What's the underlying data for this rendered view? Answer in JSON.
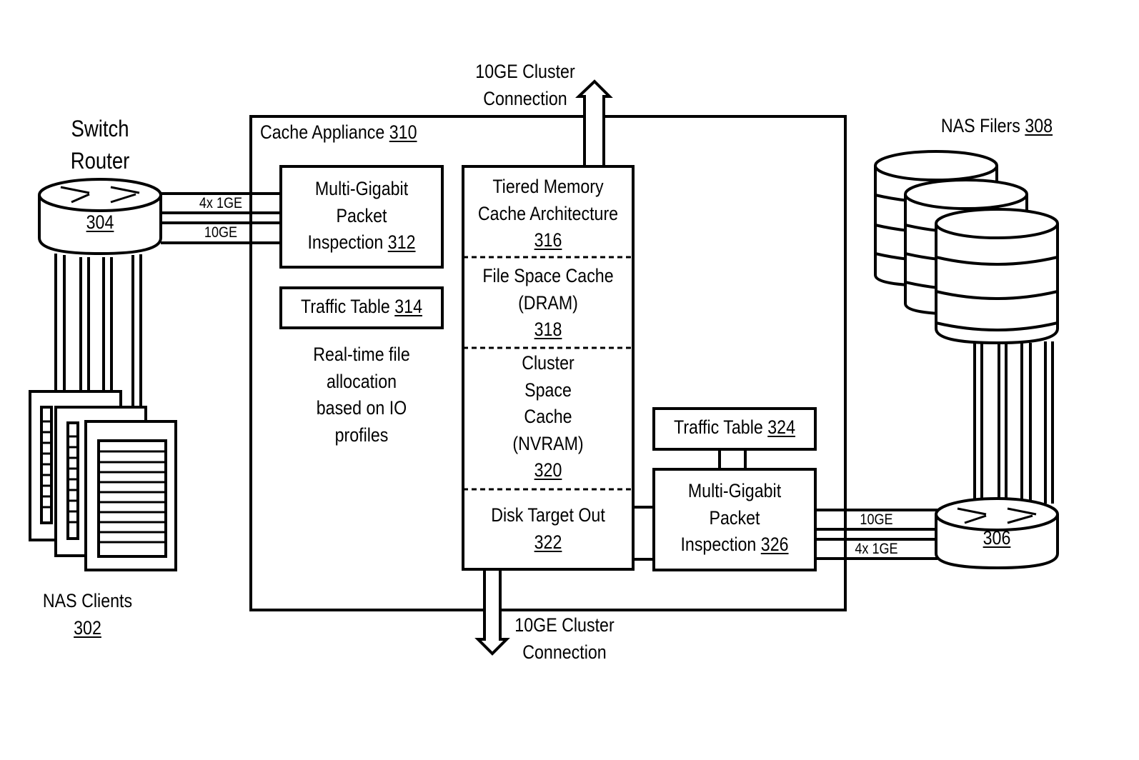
{
  "diagram": {
    "cache_appliance": {
      "label": "Cache Appliance",
      "ref": "310"
    },
    "switch_router_left": {
      "title_line1": "Switch",
      "title_line2": "Router",
      "ref": "304"
    },
    "switch_router_right": {
      "ref": "306"
    },
    "nas_clients": {
      "label": "NAS Clients",
      "ref": "302"
    },
    "nas_filers": {
      "label": "NAS Filers",
      "ref": "308"
    },
    "packet_inspection_left": {
      "line1": "Multi-Gigabit",
      "line2": "Packet",
      "line3": "Inspection",
      "ref": "312"
    },
    "traffic_table_left": {
      "label": "Traffic Table",
      "ref": "314"
    },
    "realtime_note": {
      "line1": "Real-time file",
      "line2": "allocation",
      "line3": "based on IO",
      "line4": "profiles"
    },
    "memory_stack": {
      "tier_316": {
        "line1": "Tiered Memory",
        "line2": "Cache Architecture",
        "ref": "316"
      },
      "tier_318": {
        "line1": "File Space Cache",
        "line2": "(DRAM)",
        "ref": "318"
      },
      "tier_320": {
        "line1": "Cluster",
        "line2": "Space",
        "line3": "Cache",
        "line4": "(NVRAM)",
        "ref": "320"
      },
      "tier_322": {
        "line1": "Disk Target Out",
        "ref": "322"
      }
    },
    "traffic_table_right": {
      "label": "Traffic Table",
      "ref": "324"
    },
    "packet_inspection_right": {
      "line1": "Multi-Gigabit",
      "line2": "Packet",
      "line3": "Inspection",
      "ref": "326"
    },
    "links": {
      "left_top": "4x 1GE",
      "left_bottom": "10GE",
      "right_top": "10GE",
      "right_bottom": "4x 1GE"
    },
    "cluster_top": {
      "line1": "10GE Cluster",
      "line2": "Connection"
    },
    "cluster_bottom": {
      "line1": "10GE Cluster",
      "line2": "Connection"
    }
  }
}
